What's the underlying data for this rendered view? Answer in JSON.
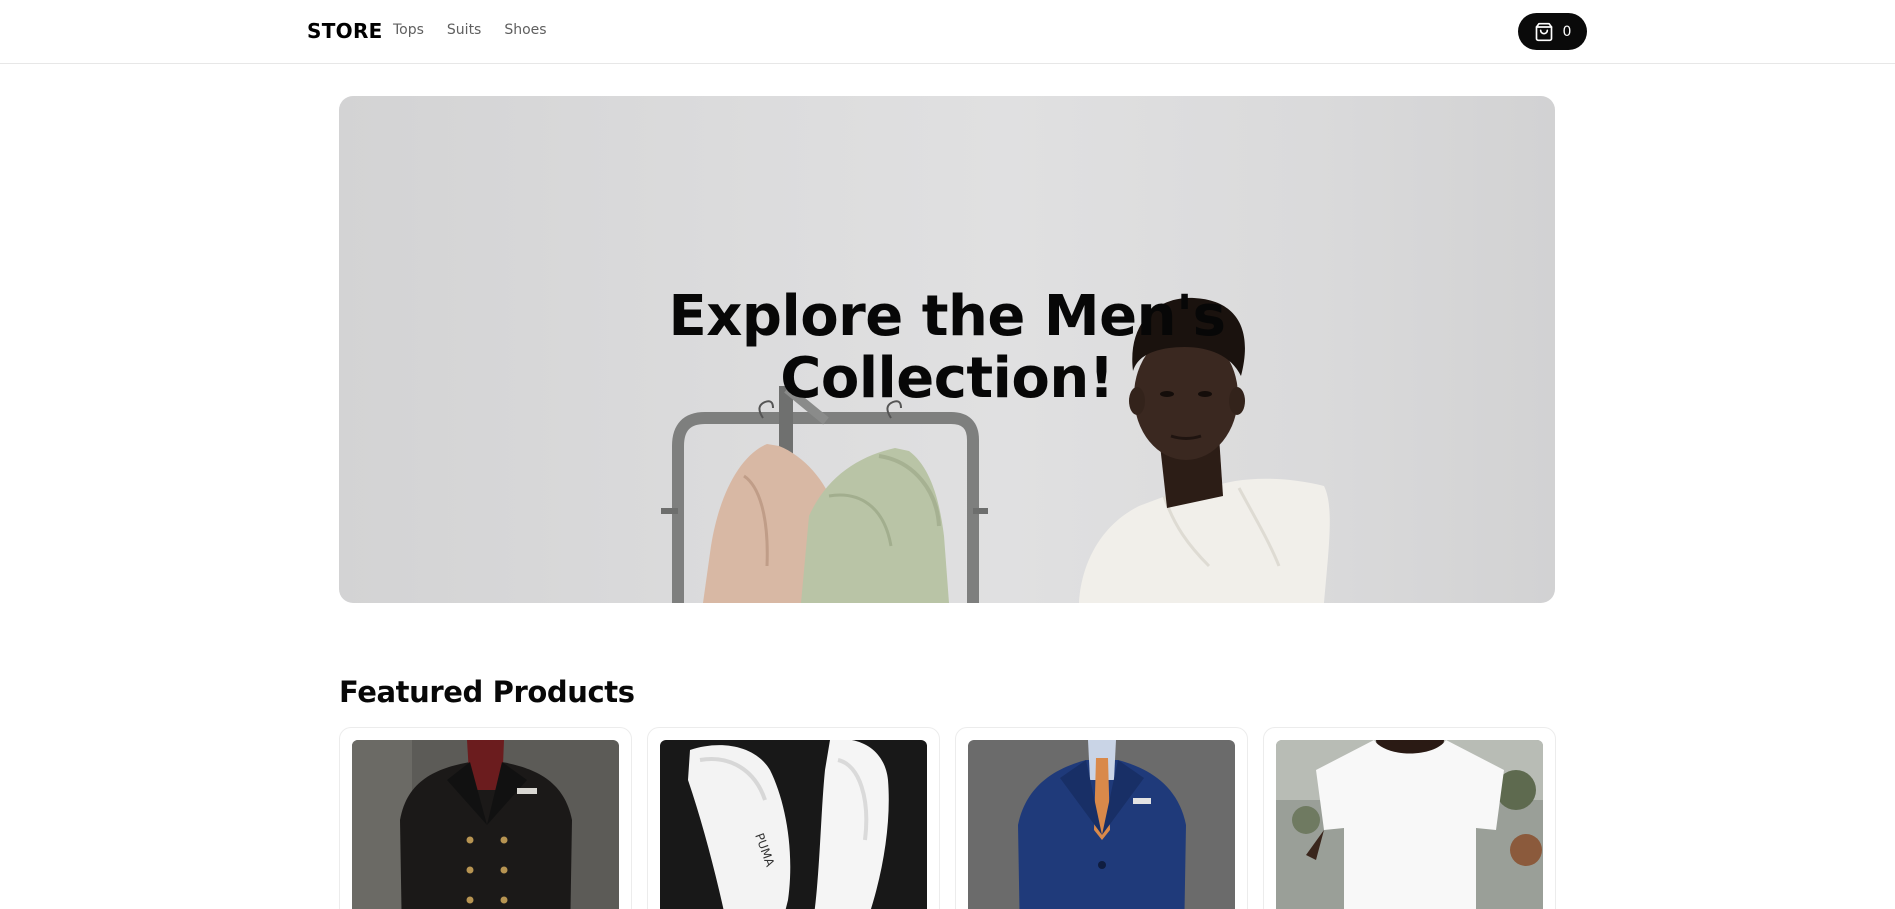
{
  "nav": {
    "brand": "STORE",
    "links": [
      "Tops",
      "Suits",
      "Shoes"
    ],
    "cart": {
      "icon": "shopping-bag-icon",
      "count": "0"
    }
  },
  "hero": {
    "title_line1": "Explore the Men's",
    "title_line2": "Collection!"
  },
  "featured": {
    "title": "Featured Products",
    "products": [
      {
        "image": "double-breasted-black-suit"
      },
      {
        "image": "white-sneakers"
      },
      {
        "image": "navy-blue-suit"
      },
      {
        "image": "white-t-shirt"
      }
    ]
  },
  "colors": {
    "accent": "#0a0a0a",
    "nav_link": "#5f5f5f",
    "hero_bg": "#dcdcdd"
  }
}
